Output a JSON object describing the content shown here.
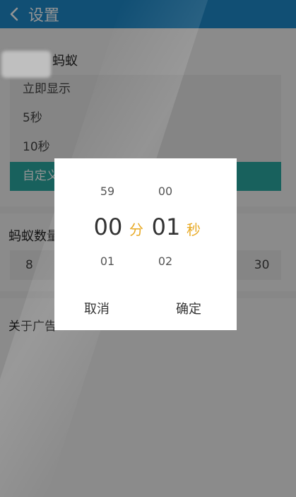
{
  "header": {
    "title": "设置"
  },
  "display": {
    "title_visible": "蚂蚁",
    "options": [
      "立即显示",
      "5秒",
      "10秒",
      "自定义"
    ],
    "selected_index": 3
  },
  "count": {
    "title_visible": "蚂蚁数量",
    "values": [
      "8",
      "",
      "",
      "",
      "",
      "",
      "30"
    ]
  },
  "about": {
    "label_visible": "关于广告"
  },
  "picker": {
    "minute": {
      "prev": "59",
      "current": "00",
      "next": "01",
      "unit": "分"
    },
    "second": {
      "prev": "00",
      "current": "01",
      "next": "02",
      "unit": "秒"
    },
    "cancel_label": "取消",
    "confirm_label": "确定"
  },
  "colors": {
    "header": "#1e88c8",
    "selected": "#2aa7a0",
    "unit": "#e8a923"
  }
}
